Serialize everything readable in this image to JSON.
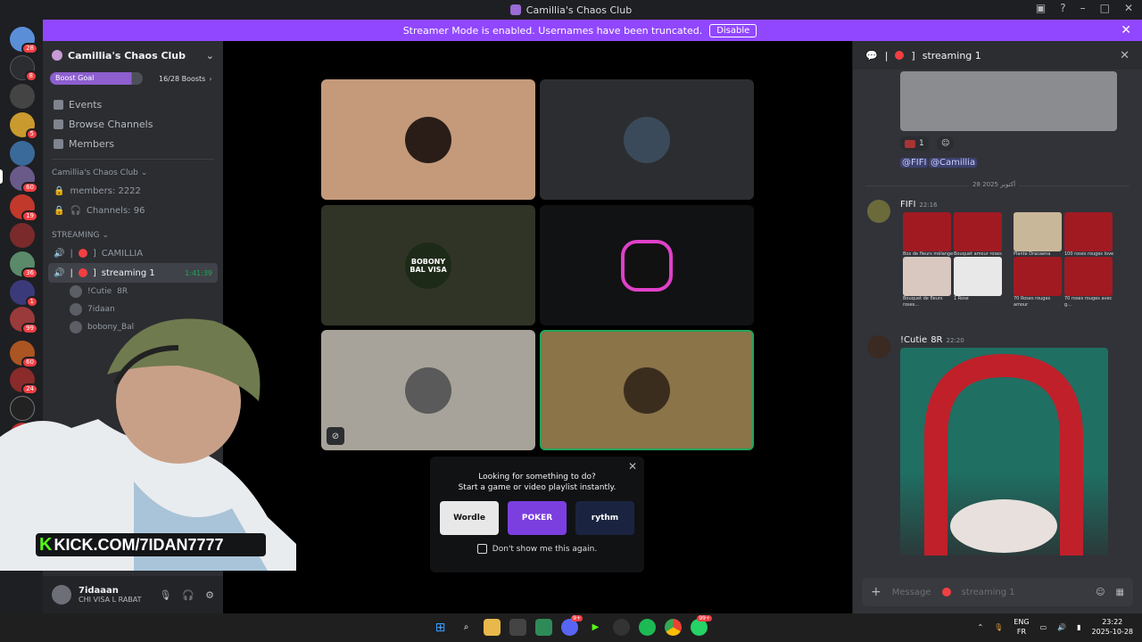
{
  "window": {
    "title": "Camillia's Chaos Club"
  },
  "banner": {
    "text": "Streamer Mode is enabled. Usernames have been truncated.",
    "disable_label": "Disable"
  },
  "serverbar": {
    "badges": [
      "28",
      "8",
      "5",
      "60",
      "19",
      "36",
      "1",
      "99",
      "60",
      "24",
      "NE"
    ]
  },
  "sidebar": {
    "guild_name": "Camillia's Chaos Club",
    "boost_label": "Boost Goal",
    "boost_count": "16/28 Boosts",
    "nav": [
      {
        "label": "Events",
        "icon": "calendar-icon"
      },
      {
        "label": "Browse Channels",
        "icon": "browse-icon"
      },
      {
        "label": "Members",
        "icon": "members-icon"
      }
    ],
    "info_category": "Camillia's Chaos Club",
    "info_channels": [
      "members: 2222",
      "Channels: 96"
    ],
    "streaming_category": "STREAMING",
    "channels": [
      {
        "name": "CAMILLIA",
        "prefix": "|",
        "suffix": "]"
      },
      {
        "name": "streaming 1",
        "prefix": "|",
        "suffix": "]",
        "timer": "1:41:39"
      }
    ],
    "voice_users": [
      "!Cutie",
      "7idaan",
      "bobony_Bal"
    ],
    "voice_user_tag": "8R"
  },
  "user_panel": {
    "name": "7idaaan",
    "status": "CHI VISA L RABAT"
  },
  "stage": {
    "tiles": [
      {
        "name": "tile-1",
        "bg": "#c49a7b",
        "avatar_bg": "#2a1d17"
      },
      {
        "name": "tile-2",
        "bg": "#2b2d31",
        "avatar_bg": "#3a4a5a"
      },
      {
        "name": "tile-3",
        "bg": "#2f3426",
        "avatar_bg": "#1d2a18",
        "avatar_text": "BOBONY BAL VISA"
      },
      {
        "name": "tile-4",
        "bg": "#111214",
        "avatar_bg": "#111"
      },
      {
        "name": "tile-5",
        "bg": "#a8a39a",
        "avatar_bg": "#5a5a5a"
      },
      {
        "name": "tile-6",
        "bg": "#8a7448",
        "avatar_bg": "#3b2d1e"
      }
    ],
    "activity": {
      "title": "Looking for something to do?",
      "subtitle": "Start a game or video playlist instantly.",
      "cards": [
        "Wordle",
        "POKER",
        "rythm"
      ],
      "checkbox_label": "Don't show me this again."
    }
  },
  "overlay": {
    "kick_url": "KICK.COM/7IDAN7777"
  },
  "chat": {
    "header_prefix": "|",
    "header_suffix": "]",
    "header_title": "streaming 1",
    "reaction_count": "1",
    "mentions": [
      "@FIFI",
      "@Camillia"
    ],
    "date_divider": "28 أكتوبر 2025",
    "messages": [
      {
        "author": "FIFI",
        "time": "22:16"
      },
      {
        "author": "!Cutie",
        "tag": "8R",
        "time": "22:20"
      }
    ],
    "products": [
      "Box de fleurs mélange 1...",
      "Bouquet amour roses",
      "Plante Dracaena fragra...",
      "100 roses rouges love",
      "Bouquet de fleurs roses...",
      "1 Rose",
      "70 Roses rouges amour",
      "70 roses rouges avec g..."
    ],
    "input_placeholder": "Message",
    "input_channel": "streaming 1"
  },
  "taskbar": {
    "lang_top": "ENG",
    "lang_bottom": "FR",
    "time": "23:22",
    "date": "2025-10-28",
    "discord_badge": "9+",
    "whatsapp_badge": "99+"
  }
}
